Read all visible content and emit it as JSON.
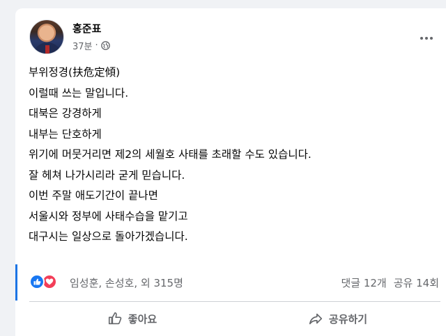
{
  "post": {
    "author": "홍준표",
    "time": "37분",
    "time_separator": "·",
    "privacy_icon": "globe-icon",
    "more_icon": "more-options-icon",
    "lines": [
      "부위정경(扶危定傾)",
      "이럴때 쓰는 말입니다.",
      "대북은 강경하게",
      "내부는 단호하게",
      "위기에 머뭇거리면 제2의 세월호 사태를 초래할 수도 있습니다.",
      "잘 헤쳐 나가시리라 굳게 믿습니다.",
      "이번 주말 애도기간이 끝나면",
      "서울시와 정부에 사태수습을 맡기고",
      "대구시는 일상으로 돌아가겠습니다."
    ]
  },
  "reactions": {
    "icons": [
      "like-icon",
      "love-icon"
    ],
    "summary": "임성훈, 손성호, 외 315명",
    "comments": "댓글 12개",
    "shares": "공유 14회"
  },
  "actions": {
    "like_label": "좋아요",
    "share_label": "공유하기"
  },
  "colors": {
    "like": "#1877f2",
    "love": "#f33e58",
    "muted_text": "#65676b",
    "accent": "#1b74e4"
  }
}
